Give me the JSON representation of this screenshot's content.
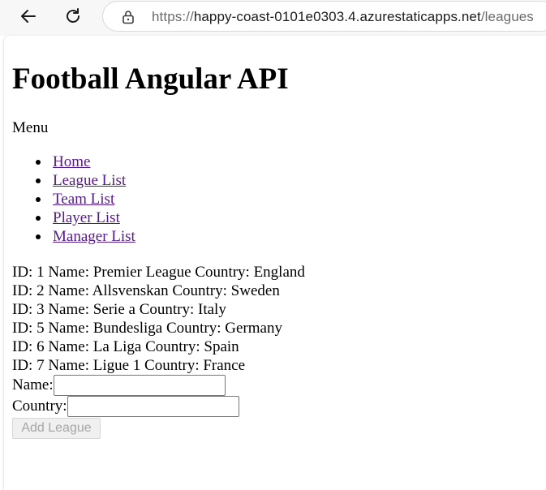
{
  "browser": {
    "url_scheme": "https://",
    "url_host": "happy-coast-0101e0303.4.azurestaticapps.net",
    "url_path": "/leagues"
  },
  "page": {
    "title": "Football Angular API",
    "menu_label": "Menu",
    "menu_items": [
      {
        "label": "Home"
      },
      {
        "label": "League List"
      },
      {
        "label": "Team List"
      },
      {
        "label": "Player List"
      },
      {
        "label": "Manager List"
      }
    ],
    "leagues": [
      "ID: 1 Name: Premier League Country: England",
      "ID: 2 Name: Allsvenskan Country: Sweden",
      "ID: 3 Name: Serie a Country: Italy",
      "ID: 5 Name: Bundesliga Country: Germany",
      "ID: 6 Name: La Liga Country: Spain",
      "ID: 7 Name: Ligue 1 Country: France"
    ],
    "form": {
      "name_label": "Name:",
      "name_value": "",
      "country_label": "Country:",
      "country_value": "",
      "submit_label": "Add League"
    }
  }
}
